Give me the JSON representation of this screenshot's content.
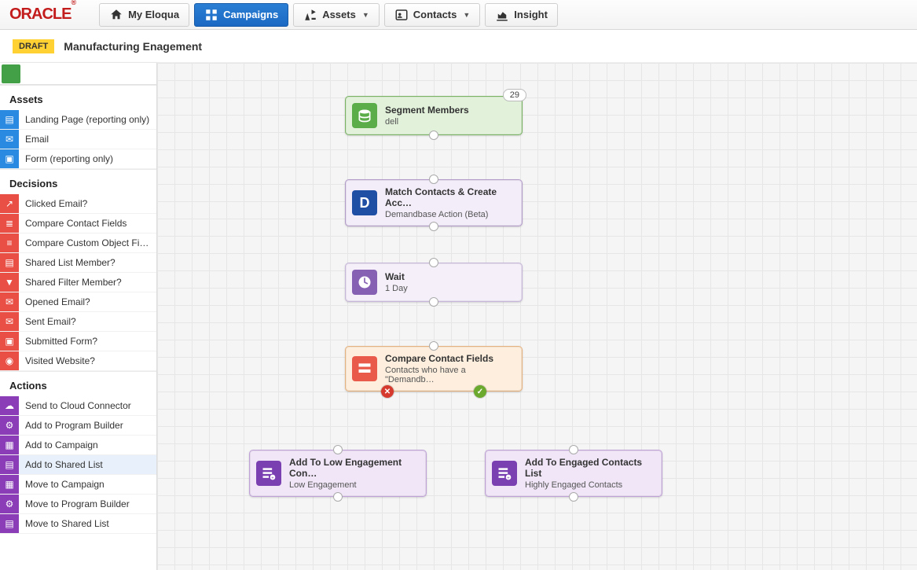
{
  "logo_text": "ORACLE",
  "nav": {
    "myeloqua": "My Eloqua",
    "campaigns": "Campaigns",
    "assets": "Assets",
    "contacts": "Contacts",
    "insight": "Insight"
  },
  "header": {
    "draft_badge": "DRAFT",
    "title": "Manufacturing Enagement"
  },
  "sidebar": {
    "cut_item_label": "Segment Members",
    "assets_header": "Assets",
    "assets": [
      {
        "label": "Landing Page (reporting only)"
      },
      {
        "label": "Email"
      },
      {
        "label": "Form (reporting only)"
      }
    ],
    "decisions_header": "Decisions",
    "decisions": [
      {
        "label": "Clicked Email?"
      },
      {
        "label": "Compare Contact Fields"
      },
      {
        "label": "Compare Custom Object Fields"
      },
      {
        "label": "Shared List Member?"
      },
      {
        "label": "Shared Filter Member?"
      },
      {
        "label": "Opened Email?"
      },
      {
        "label": "Sent Email?"
      },
      {
        "label": "Submitted Form?"
      },
      {
        "label": "Visited Website?"
      }
    ],
    "actions_header": "Actions",
    "actions": [
      {
        "label": "Send to Cloud Connector"
      },
      {
        "label": "Add to Program Builder"
      },
      {
        "label": "Add to Campaign"
      },
      {
        "label": "Add to Shared List"
      },
      {
        "label": "Move to Campaign"
      },
      {
        "label": "Move to Program Builder"
      },
      {
        "label": "Move to Shared List"
      }
    ]
  },
  "canvas": {
    "segment": {
      "title": "Segment Members",
      "sub": "dell",
      "count": "29"
    },
    "match": {
      "title": "Match Contacts & Create Acc…",
      "sub": "Demandbase Action (Beta)"
    },
    "wait": {
      "title": "Wait",
      "sub": "1 Day"
    },
    "compare": {
      "title": "Compare Contact Fields",
      "sub": "Contacts who have a \"Demandb…"
    },
    "low": {
      "title": "Add To Low Engagement Con…",
      "sub": "Low Engagement"
    },
    "high": {
      "title": "Add To Engaged Contacts List",
      "sub": "Highly Engaged Contacts"
    }
  }
}
